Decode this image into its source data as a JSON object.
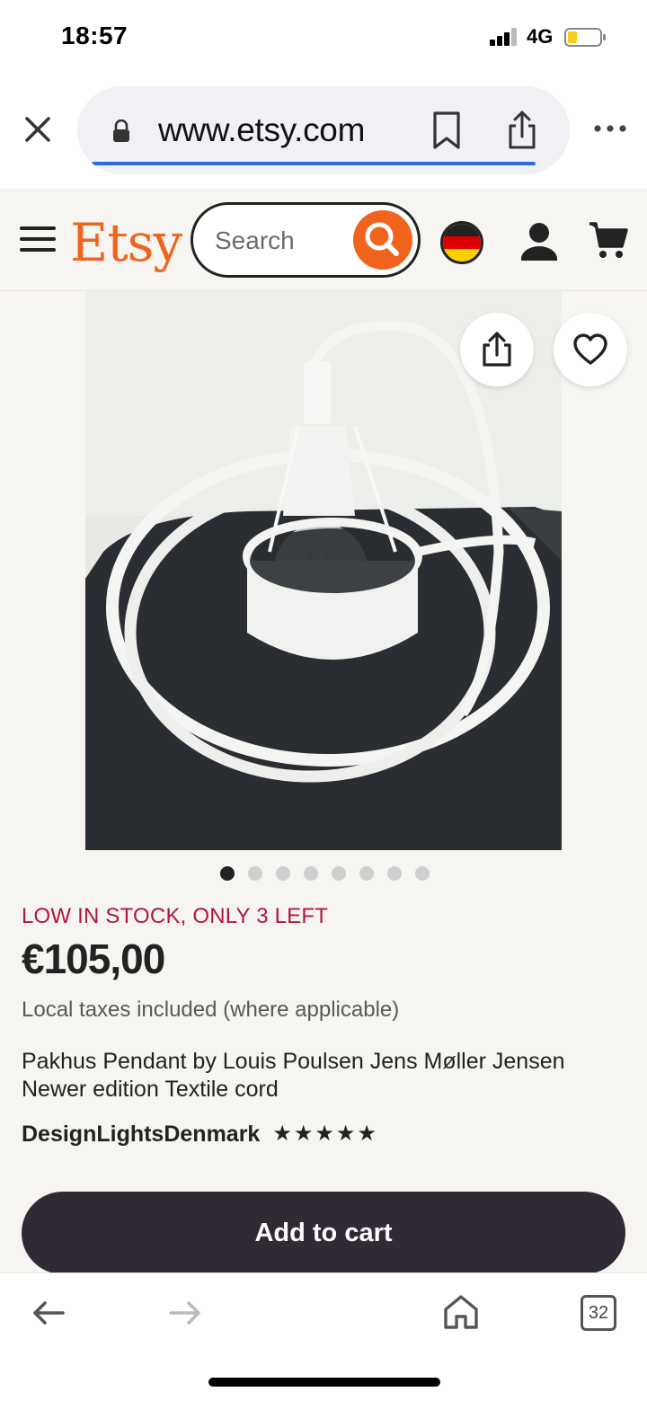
{
  "status_bar": {
    "time": "18:57",
    "network": "4G"
  },
  "browser": {
    "url": "www.etsy.com",
    "tab_count": "32"
  },
  "header": {
    "logo": "Etsy",
    "search_placeholder": "Search"
  },
  "product": {
    "image_count": 8,
    "active_image": 1,
    "stock_notice": "LOW IN STOCK, ONLY 3 LEFT",
    "price": "€105,00",
    "tax_note": "Local taxes included (where applicable)",
    "title": "Pakhus Pendant by Louis Poulsen Jens Møller Jensen Newer edition Textile cord",
    "shop_name": "DesignLightsDenmark",
    "rating_stars": 5,
    "add_to_cart_label": "Add to cart"
  },
  "colors": {
    "etsy_orange": "#f1641e",
    "stock_red": "#b2163a",
    "cart_button": "#2f2a33",
    "page_bg": "#f7f5f2",
    "url_progress": "#2d6ae6"
  },
  "icons": [
    "close-icon",
    "lock-icon",
    "bookmark-icon",
    "share-icon",
    "more-icon",
    "menu-icon",
    "search-icon",
    "flag-germany-icon",
    "user-icon",
    "cart-icon",
    "heart-icon",
    "star-icon",
    "back-arrow-icon",
    "forward-arrow-icon",
    "home-icon",
    "tabs-icon"
  ]
}
